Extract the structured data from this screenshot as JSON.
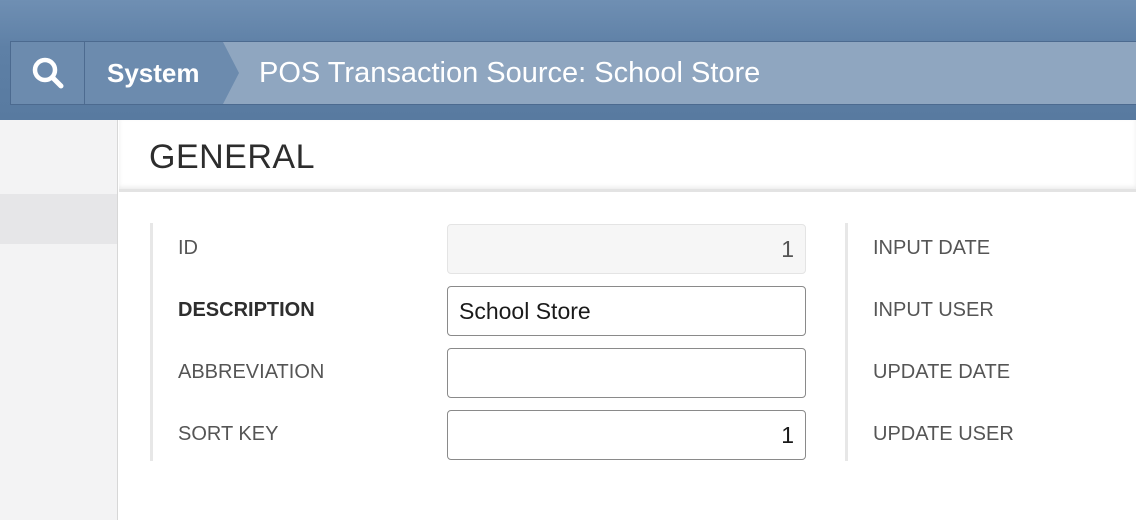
{
  "breadcrumb": {
    "search_icon": "search-icon",
    "system_label": "System",
    "page_title": "POS Transaction Source: School Store"
  },
  "section": {
    "title": "GENERAL"
  },
  "form": {
    "id_label": "ID",
    "id_value": "1",
    "description_label": "DESCRIPTION",
    "description_value": "School Store",
    "abbreviation_label": "ABBREVIATION",
    "abbreviation_value": "",
    "sort_key_label": "SORT KEY",
    "sort_key_value": "1"
  },
  "meta": {
    "input_date_label": "INPUT DATE",
    "input_user_label": "INPUT USER",
    "update_date_label": "UPDATE DATE",
    "update_user_label": "UPDATE USER"
  },
  "colors": {
    "header_bar": "#5e80a6",
    "breadcrumb_bg": "#8fa6c0",
    "breadcrumb_active": "#6c8bae"
  }
}
